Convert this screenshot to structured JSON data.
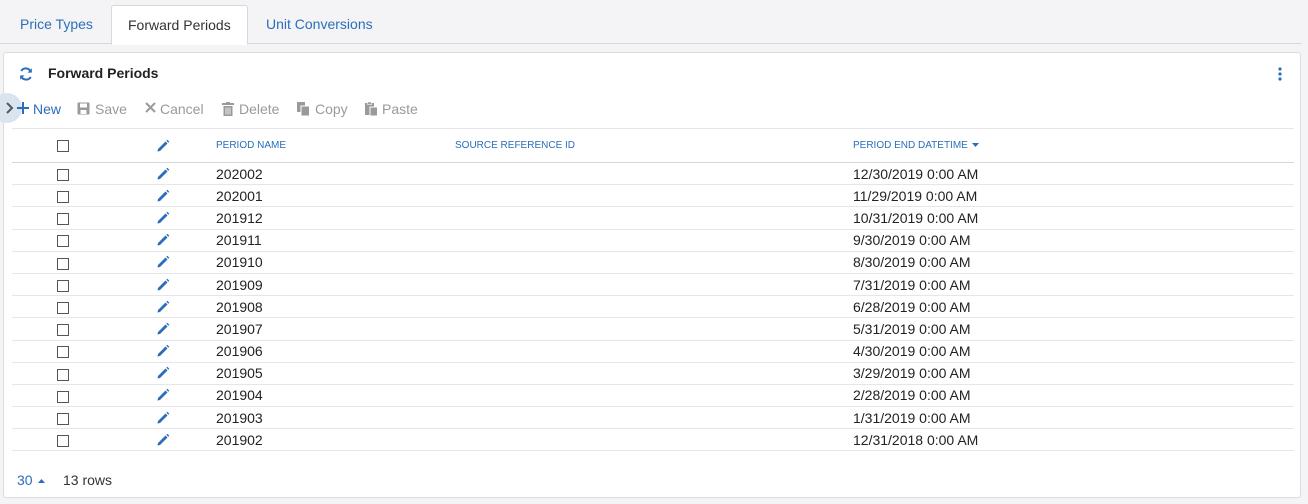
{
  "tabs": [
    {
      "label": "Price Types",
      "active": false
    },
    {
      "label": "Forward Periods",
      "active": true
    },
    {
      "label": "Unit Conversions",
      "active": false
    }
  ],
  "panel": {
    "title": "Forward Periods"
  },
  "toolbar": {
    "new_label": "New",
    "save_label": "Save",
    "cancel_label": "Cancel",
    "delete_label": "Delete",
    "copy_label": "Copy",
    "paste_label": "Paste"
  },
  "table": {
    "columns": {
      "period_name": "PERIOD NAME",
      "source_reference_id": "SOURCE REFERENCE ID",
      "period_end_datetime": "PERIOD END DATETIME"
    },
    "sort": {
      "column": "period_end_datetime",
      "direction": "descending"
    },
    "rows": [
      {
        "period_name": "202002",
        "source_reference_id": "",
        "period_end_datetime": "12/30/2019 0:00 AM"
      },
      {
        "period_name": "202001",
        "source_reference_id": "",
        "period_end_datetime": "11/29/2019 0:00 AM"
      },
      {
        "period_name": "201912",
        "source_reference_id": "",
        "period_end_datetime": "10/31/2019 0:00 AM"
      },
      {
        "period_name": "201911",
        "source_reference_id": "",
        "period_end_datetime": "9/30/2019 0:00 AM"
      },
      {
        "period_name": "201910",
        "source_reference_id": "",
        "period_end_datetime": "8/30/2019 0:00 AM"
      },
      {
        "period_name": "201909",
        "source_reference_id": "",
        "period_end_datetime": "7/31/2019 0:00 AM"
      },
      {
        "period_name": "201908",
        "source_reference_id": "",
        "period_end_datetime": "6/28/2019 0:00 AM"
      },
      {
        "period_name": "201907",
        "source_reference_id": "",
        "period_end_datetime": "5/31/2019 0:00 AM"
      },
      {
        "period_name": "201906",
        "source_reference_id": "",
        "period_end_datetime": "4/30/2019 0:00 AM"
      },
      {
        "period_name": "201905",
        "source_reference_id": "",
        "period_end_datetime": "3/29/2019 0:00 AM"
      },
      {
        "period_name": "201904",
        "source_reference_id": "",
        "period_end_datetime": "2/28/2019 0:00 AM"
      },
      {
        "period_name": "201903",
        "source_reference_id": "",
        "period_end_datetime": "1/31/2019 0:00 AM"
      },
      {
        "period_name": "201902",
        "source_reference_id": "",
        "period_end_datetime": "12/31/2018 0:00 AM"
      }
    ]
  },
  "footer": {
    "page_size": "30",
    "row_count": "13 rows"
  },
  "colors": {
    "accent": "#2a6ebb",
    "disabled": "#9a9a9a",
    "background": "#f4f4f6"
  },
  "icons": [
    "refresh-icon",
    "kebab-menu-icon",
    "chevron-right-icon",
    "plus-icon",
    "save-icon",
    "x-icon",
    "trash-icon",
    "copy-icon",
    "paste-icon",
    "pencil-icon",
    "caret-down-icon",
    "caret-up-icon"
  ]
}
